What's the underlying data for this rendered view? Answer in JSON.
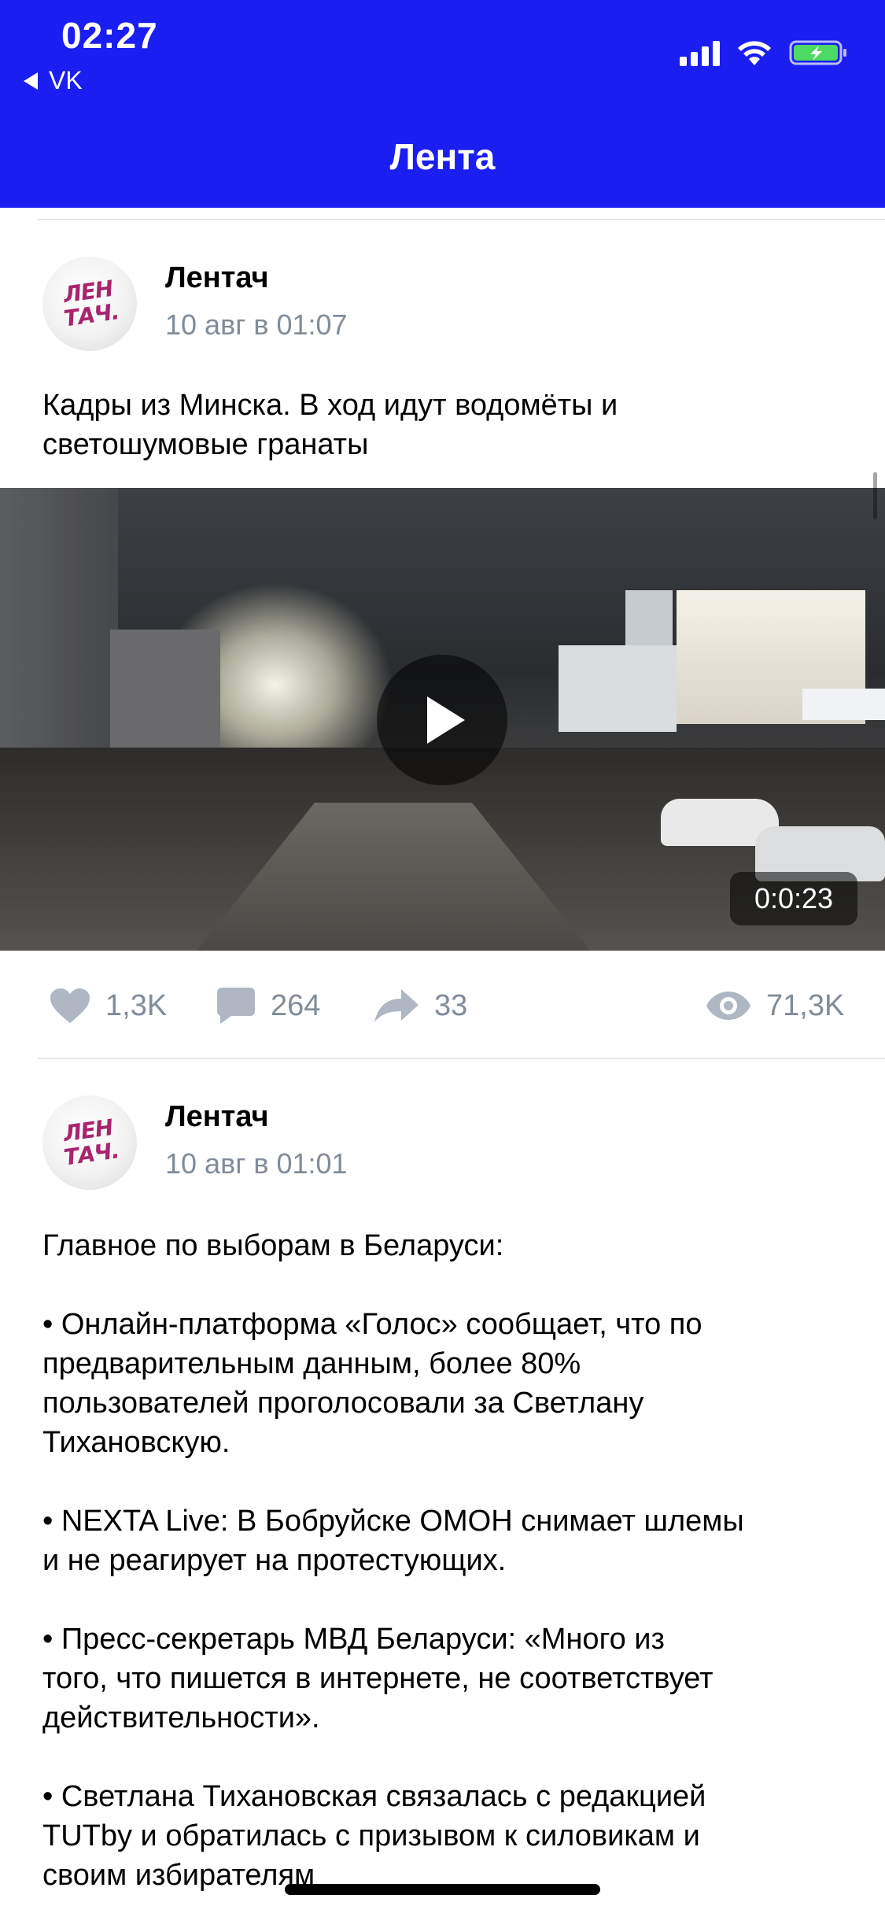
{
  "status_bar": {
    "time": "02:27",
    "back_app": "VK",
    "signal_icon": "signal-icon",
    "wifi_icon": "wifi-icon",
    "battery_icon": "battery-charging-icon",
    "battery_color": "#4cd964"
  },
  "header": {
    "title": "Лента",
    "background": "#1a1ef0"
  },
  "posts": [
    {
      "author": "Лентач",
      "avatar_text": "ЛЕН ТАЧ.",
      "date": "10 авг в 01:07",
      "text_lines": [
        "Кадры из Минска. В ход идут водомёты и",
        "светошумовые гранаты"
      ],
      "video": {
        "duration": "0:0:23"
      },
      "actions": {
        "likes": "1,3K",
        "comments": "264",
        "shares": "33",
        "views": "71,3K"
      }
    },
    {
      "author": "Лентач",
      "avatar_text": "ЛЕН ТАЧ.",
      "date": "10 авг в 01:01",
      "paragraphs": [
        [
          "Главное по выборам в Беларуси:"
        ],
        [
          "• Онлайн-платформа «Голос» сообщает, что по",
          "предварительным данным, более 80%",
          "пользователей проголосовали за Светлану",
          "Тихановскую."
        ],
        [
          "• NEXTA Live: В Бобруйске ОМОН снимает шлемы",
          "и не реагирует на протестующих."
        ],
        [
          "• Пресс-секретарь МВД Беларуси: «Много из",
          "того, что пишется в интернете, не соответствует",
          "действительности»."
        ],
        [
          "• Светлана Тихановская связалась с редакцией",
          "TUTby и обратилась с призывом к силовикам и",
          "своим избирателям"
        ]
      ]
    }
  ]
}
